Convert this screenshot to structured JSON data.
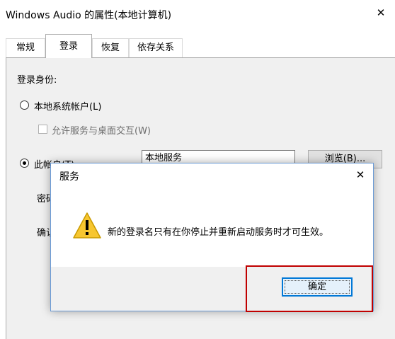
{
  "window": {
    "title": "Windows Audio 的属性(本地计算机)",
    "close_glyph": "✕"
  },
  "tabs": [
    {
      "label": "常规"
    },
    {
      "label": "登录"
    },
    {
      "label": "恢复"
    },
    {
      "label": "依存关系"
    }
  ],
  "logon": {
    "section_label": "登录身份:",
    "local_system_label": "本地系统帐户(L)",
    "allow_desktop_label": "允许服务与桌面交互(W)",
    "this_account_label": "此帐户(T):",
    "account_value": "本地服务",
    "browse_label": "浏览(B)...",
    "password_label": "密码",
    "confirm_label": "确认"
  },
  "dialog": {
    "title": "服务",
    "close_glyph": "✕",
    "message": "新的登录名只有在你停止并重新启动服务时才可生效。",
    "icon": "warning-icon",
    "ok_label": "确定"
  },
  "colors": {
    "accent": "#0078d7",
    "highlight": "#c00000",
    "warning": "#f7c630"
  }
}
